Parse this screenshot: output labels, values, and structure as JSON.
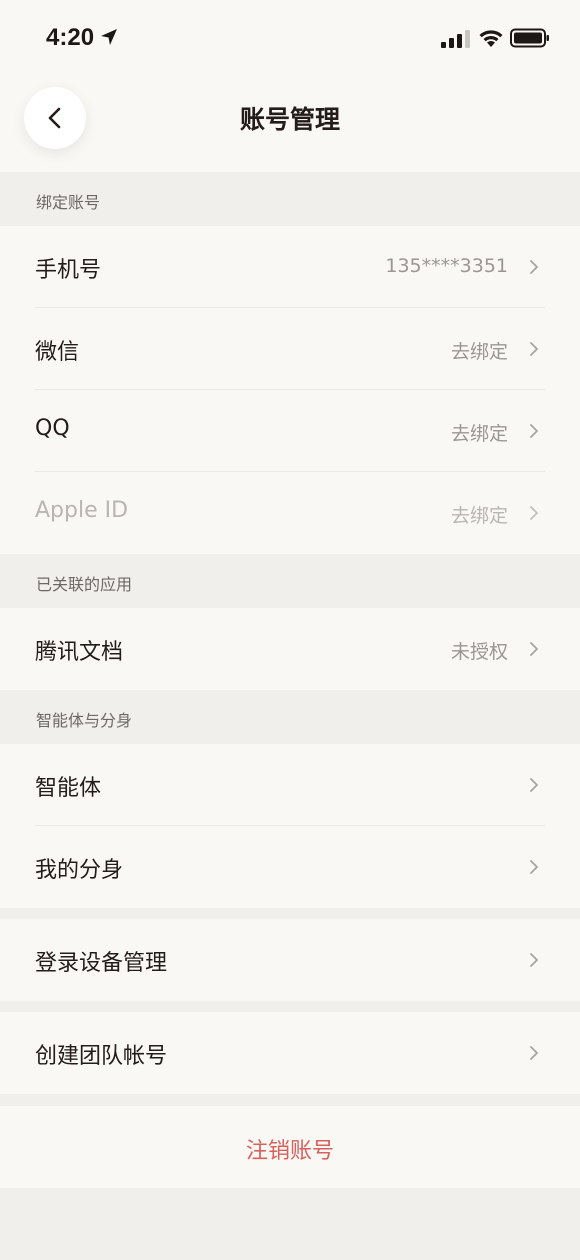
{
  "status_bar": {
    "time": "4:20"
  },
  "nav": {
    "title": "账号管理"
  },
  "sections": {
    "bind": {
      "header": "绑定账号",
      "rows": [
        {
          "label": "手机号",
          "value": "135****3351"
        },
        {
          "label": "微信",
          "value": "去绑定"
        },
        {
          "label": "QQ",
          "value": "去绑定"
        },
        {
          "label": "Apple ID",
          "value": "去绑定"
        }
      ]
    },
    "linked_apps": {
      "header": "已关联的应用",
      "rows": [
        {
          "label": "腾讯文档",
          "value": "未授权"
        }
      ]
    },
    "agents": {
      "header": "智能体与分身",
      "rows": [
        {
          "label": "智能体"
        },
        {
          "label": "我的分身"
        }
      ]
    },
    "devices": {
      "rows": [
        {
          "label": "登录设备管理"
        }
      ]
    },
    "team": {
      "rows": [
        {
          "label": "创建团队帐号"
        }
      ]
    }
  },
  "logout": {
    "label": "注销账号"
  },
  "colors": {
    "danger": "#d9605b",
    "background": "#f0efec",
    "card": "#f9f8f5"
  }
}
